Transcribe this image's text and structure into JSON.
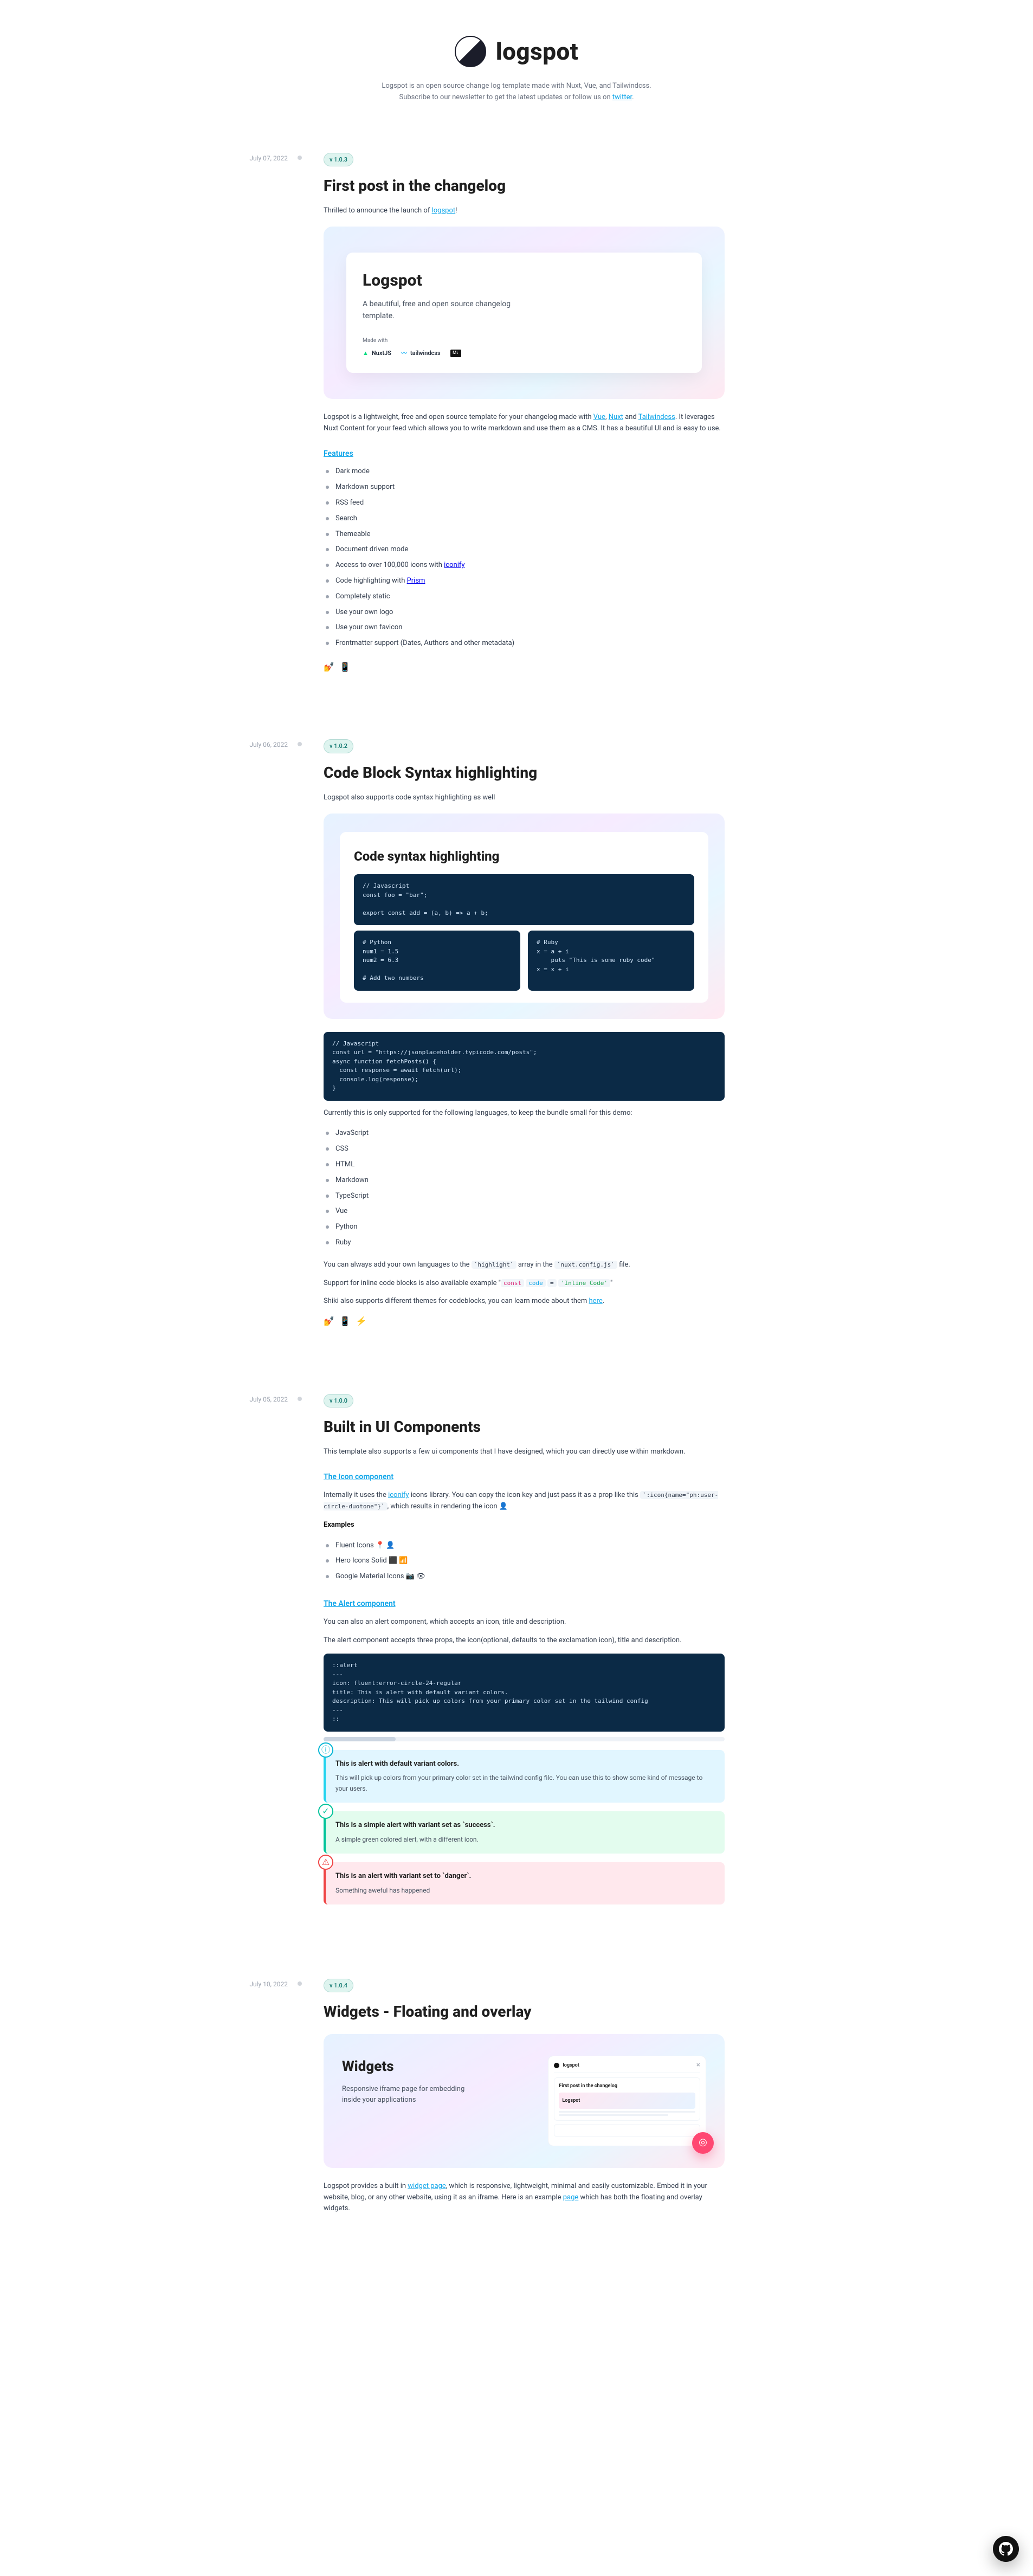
{
  "site": {
    "name": "logspot",
    "tagline": "Logspot is an open source change log template made with Nuxt, Vue, and Tailwindcss. Subscribe to our newsletter to get the latest updates or follow us on ",
    "tagline_link": "twitter"
  },
  "posts": [
    {
      "date": "July 07, 2022",
      "version": "v 1.0.3",
      "title": "First post in the changelog",
      "intro_prefix": "Thrilled to announce the launch of ",
      "intro_link": "logspot",
      "card": {
        "title": "Logspot",
        "subtitle": "A beautiful, free and open source changelog template.",
        "madewith_label": "Made with",
        "tech": [
          "NuxtJS",
          "tailwindcss",
          "M↓"
        ]
      },
      "body_1_prefix": "Logspot is a lightweight, free and open source template for your changelog made with ",
      "body_1_links": [
        "Vue",
        "Nuxt",
        "Tailwindcss"
      ],
      "body_1_mid": " and ",
      "body_1_suffix": ". It leverages Nuxt Content for your feed which allows you to write markdown and use them as a CMS. It has a beautiful UI and is easy to use.",
      "features_heading": "Features",
      "features": [
        {
          "t": "Dark mode"
        },
        {
          "t": "Markdown support"
        },
        {
          "t": "RSS feed"
        },
        {
          "t": "Search"
        },
        {
          "t": "Themeable"
        },
        {
          "t": "Document driven mode"
        },
        {
          "t": "Access to over 100,000 icons with ",
          "link": "iconify"
        },
        {
          "t": "Code highlighting with ",
          "link": "Prism"
        },
        {
          "t": "Completely static"
        },
        {
          "t": "Use your own logo"
        },
        {
          "t": "Use your own favicon"
        },
        {
          "t": "Frontmatter support (Dates, Authors and other metadata)"
        }
      ],
      "emoji": [
        "💅",
        "📱"
      ]
    },
    {
      "date": "July 06, 2022",
      "version": "v 1.0.2",
      "title": "Code Block Syntax highlighting",
      "intro": "Logspot also supports code syntax highlighting as well",
      "card_title": "Code syntax highlighting",
      "code_js_top": "// Javascript\nconst foo = \"bar\";\n\nexport const add = (a, b) => a + b;",
      "code_py": "# Python\nnum1 = 1.5\nnum2 = 6.3\n\n# Add two numbers",
      "code_rb": "# Ruby\nx = a + i\n    puts \"This is some ruby code\"\nx = x + i",
      "code_main": "// Javascript\nconst url = \"https://jsonplaceholder.typicode.com/posts\";\nasync function fetchPosts() {\n  const response = await fetch(url);\n  console.log(response);\n}",
      "after_code_1": "Currently this is only supported for the following languages, to keep the bundle small for this demo:",
      "langs": [
        "JavaScript",
        "CSS",
        "HTML",
        "Markdown",
        "TypeScript",
        "Vue",
        "Python",
        "Ruby"
      ],
      "after_langs_prefix": "You can always add your own languages to the ",
      "code_arr": "`highlight`",
      "after_langs_mid": " array in the ",
      "code_file": "`nuxt.config.js`",
      "after_langs_suffix": " file.",
      "inline_support_prefix": "Support for inline code blocks is also available example \"",
      "inline_code_1": "const code = 'Inline Code'",
      "inline_support_suffix": "\"",
      "shiki_prefix": "Shiki also supports different themes for codeblocks, you can learn mode about them ",
      "shiki_link": "here",
      "emoji": [
        "💅",
        "📱",
        "⚡"
      ]
    },
    {
      "date": "July 05, 2022",
      "version": "v 1.0.0",
      "title": "Built in UI Components",
      "intro": "This template also supports a few ui components that I have designed, which you can directly use within markdown.",
      "icon_heading": "The Icon component",
      "icon_p_prefix": "Internally it uses the ",
      "icon_p_link": "iconify",
      "icon_p_mid": " icons library. You can copy the icon key and just pass it as a prop like this ",
      "icon_code": "`:icon{name=\"ph:user-circle-duotone\"}`",
      "icon_p_suffix": ", which results in rendering the icon 👤",
      "examples_heading": "Examples",
      "examples": [
        {
          "label": "Fluent Icons ",
          "icons": "📍 👤"
        },
        {
          "label": "Hero Icons Solid ",
          "icons": "⬛ 📶"
        },
        {
          "label": "Google Material Icons ",
          "icons": "📷 👁"
        }
      ],
      "alert_heading": "The Alert component",
      "alert_intro_1": "You can also an alert component, which accepts an icon, title and description.",
      "alert_intro_2": "The alert component accepts three props, the icon(optional, defaults to the exclamation icon), title and description.",
      "alert_code": "::alert\n---\nicon: fluent:error-circle-24-regular\ntitle: This is alert with default variant colors.\ndescription: This will pick up colors from your primary color set in the tailwind config\n---\n::",
      "alerts": [
        {
          "variant": "default",
          "title": "This is alert with default variant colors.",
          "desc": "This will pick up colors from your primary color set in the tailwind config file. You can use this to show some kind of message to your users."
        },
        {
          "variant": "success",
          "title": "This is a simple alert with variant set as `success`.",
          "desc": "A simple green colored alert, with a different icon."
        },
        {
          "variant": "danger",
          "title": "This is an alert with variant set to `danger`.",
          "desc": "Something aweful has happened"
        }
      ]
    },
    {
      "date": "July 10, 2022",
      "version": "v 1.0.4",
      "title": "Widgets - Floating and overlay",
      "card": {
        "title": "Widgets",
        "subtitle": "Responsive iframe page for embedding inside your applications",
        "preview_header": "logspot",
        "preview_post_title": "First post in the changelog"
      },
      "body_prefix": "Logspot provides a built in ",
      "body_link_1": "widget page",
      "body_mid": ", which is responsive, lightweight, minimal and easily customizable. Embed it in your website, blog, or any other website, using it as an iframe. Here is an example ",
      "body_link_2": "page",
      "body_suffix": " which has both the floating and overlay widgets."
    }
  ]
}
